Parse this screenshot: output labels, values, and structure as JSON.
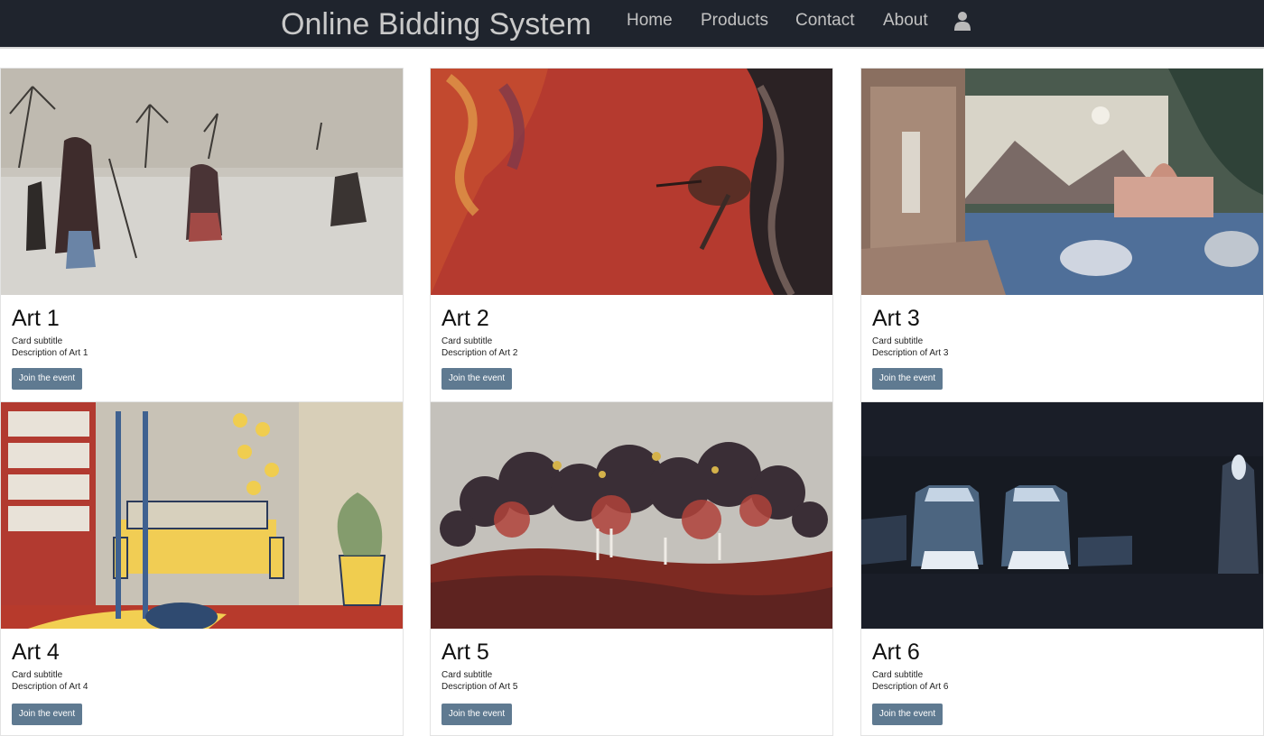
{
  "header": {
    "brand": "Online Bidding System",
    "nav": [
      "Home",
      "Products",
      "Contact",
      "About"
    ],
    "user_icon": "user-icon"
  },
  "cards": [
    {
      "title": "Art 1",
      "subtitle": "Card subtitle",
      "description": "Description of Art 1",
      "button": "Join the event"
    },
    {
      "title": "Art 2",
      "subtitle": "Card subtitle",
      "description": "Description of Art 2",
      "button": "Join the event"
    },
    {
      "title": "Art 3",
      "subtitle": "Card subtitle",
      "description": "Description of Art 3",
      "button": "Join the event"
    },
    {
      "title": "Art 4",
      "subtitle": "Card subtitle",
      "description": "Description of Art 4",
      "button": "Join the event"
    },
    {
      "title": "Art 5",
      "subtitle": "Card subtitle",
      "description": "Description of Art 5",
      "button": "Join the event"
    },
    {
      "title": "Art 6",
      "subtitle": "Card subtitle",
      "description": "Description of Art 6",
      "button": "Join the event"
    }
  ],
  "colors": {
    "navbar": "#1f242d",
    "nav_text": "#c2c2c2",
    "button": "#5f7a91"
  }
}
